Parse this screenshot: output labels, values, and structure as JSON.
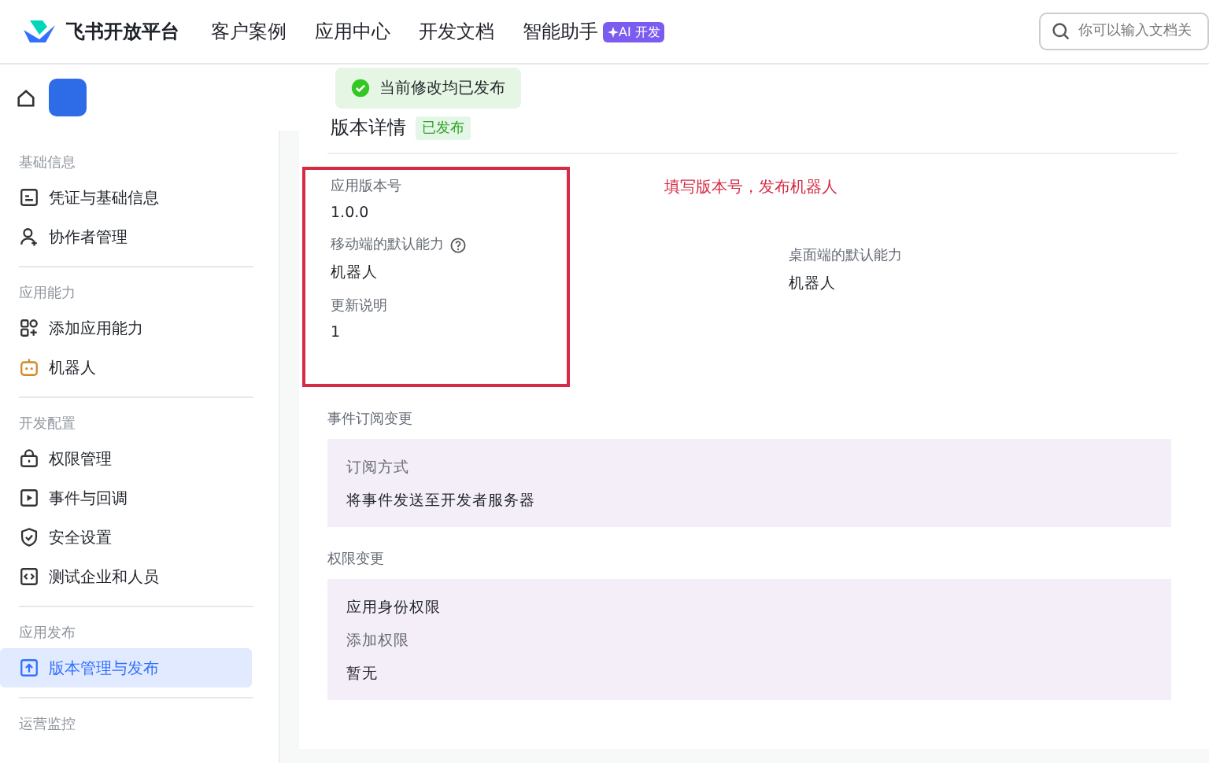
{
  "topnav": {
    "brand": "飞书开放平台",
    "links": [
      {
        "label": "客户案例"
      },
      {
        "label": "应用中心"
      },
      {
        "label": "开发文档"
      },
      {
        "label": "智能助手",
        "badge": "AI 开发"
      }
    ],
    "search": {
      "placeholder": "你可以输入文档关"
    }
  },
  "toast": {
    "text": "当前修改均已发布"
  },
  "sidebar": {
    "sections": [
      {
        "heading": "基础信息",
        "items": [
          {
            "label": "凭证与基础信息",
            "selected": false
          },
          {
            "label": "协作者管理",
            "selected": false
          }
        ]
      },
      {
        "heading": "应用能力",
        "items": [
          {
            "label": "添加应用能力",
            "selected": false
          },
          {
            "label": "机器人",
            "selected": false
          }
        ]
      },
      {
        "heading": "开发配置",
        "items": [
          {
            "label": "权限管理",
            "selected": false
          },
          {
            "label": "事件与回调",
            "selected": false
          },
          {
            "label": "安全设置",
            "selected": false
          },
          {
            "label": "测试企业和人员",
            "selected": false
          }
        ]
      },
      {
        "heading": "应用发布",
        "items": [
          {
            "label": "版本管理与发布",
            "selected": true
          }
        ]
      },
      {
        "heading": "运营监控"
      }
    ]
  },
  "version": {
    "title": "版本详情",
    "status": "已发布",
    "annotation": "填写版本号，发布机器人",
    "fields": [
      {
        "label": "应用版本号",
        "value": "1.0.0"
      },
      {
        "label": "移动端的默认能力",
        "value": "机器人",
        "help": true
      },
      {
        "label": "桌面端的默认能力",
        "value": "机器人"
      },
      {
        "label": "更新说明",
        "value": "1"
      }
    ]
  },
  "events": {
    "heading": "事件订阅变更",
    "label": "订阅方式",
    "value": "将事件发送至开发者服务器"
  },
  "permissions": {
    "heading": "权限变更",
    "title": "应用身份权限",
    "label": "添加权限",
    "value": "暂无"
  }
}
